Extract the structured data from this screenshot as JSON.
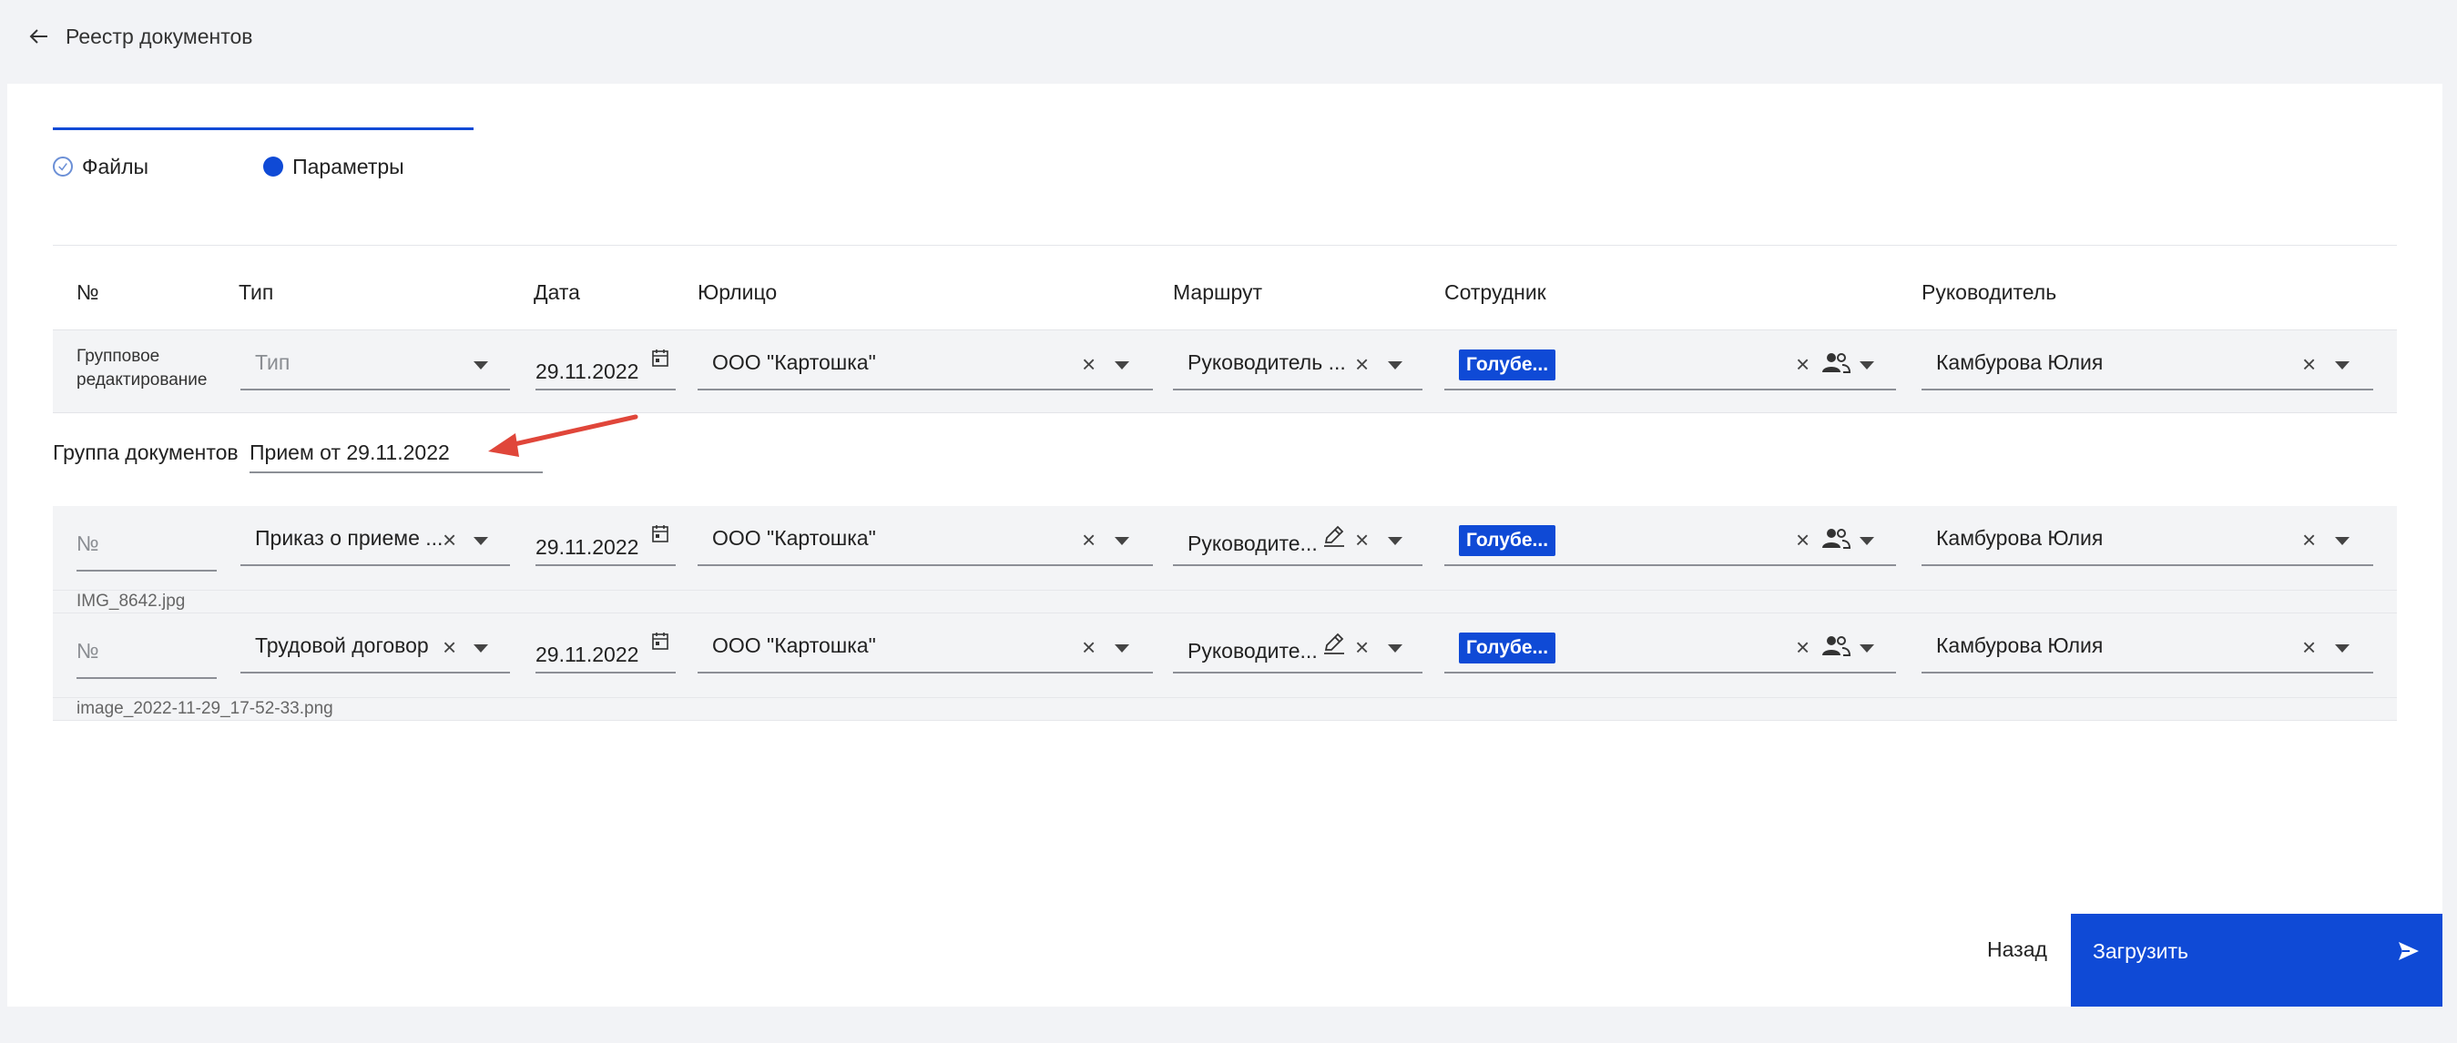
{
  "header": {
    "back_label": "Реестр документов"
  },
  "steps": [
    {
      "label": "Файлы",
      "state": "done"
    },
    {
      "label": "Параметры",
      "state": "active"
    }
  ],
  "columns": {
    "num": "№",
    "type": "Тип",
    "date": "Дата",
    "entity": "Юрлицо",
    "route": "Маршрут",
    "employee": "Сотрудник",
    "manager": "Руководитель"
  },
  "bulk_row": {
    "label_line1": "Групповое",
    "label_line2": "редактирование",
    "type_placeholder": "Тип",
    "date": "29.11.2022",
    "entity": "ООО \"Картошка\"",
    "route": "Руководитель ...",
    "employee_tag": "Голубе...",
    "manager": "Камбурова Юлия"
  },
  "group": {
    "label": "Группа документов",
    "value": "Прием от 29.11.2022"
  },
  "documents": [
    {
      "num_placeholder": "№",
      "type": "Приказ о приеме ...",
      "date": "29.11.2022",
      "entity": "ООО \"Картошка\"",
      "route": "Руководите...",
      "employee_tag": "Голубе...",
      "manager": "Камбурова Юлия",
      "file": "IMG_8642.jpg"
    },
    {
      "num_placeholder": "№",
      "type": "Трудовой договор",
      "date": "29.11.2022",
      "entity": "ООО \"Картошка\"",
      "route": "Руководите...",
      "employee_tag": "Голубе...",
      "manager": "Камбурова Юлия",
      "file": "image_2022-11-29_17-52-33.png"
    }
  ],
  "footer": {
    "back_label": "Назад",
    "upload_label": "Загрузить"
  },
  "colors": {
    "accent": "#0f4ad6",
    "annotation_arrow": "#e0463a"
  },
  "icons": [
    "arrow-left-icon",
    "check-circle-icon",
    "calendar-icon",
    "close-icon",
    "chevron-down-icon",
    "people-icon",
    "pencil-icon",
    "send-icon"
  ]
}
